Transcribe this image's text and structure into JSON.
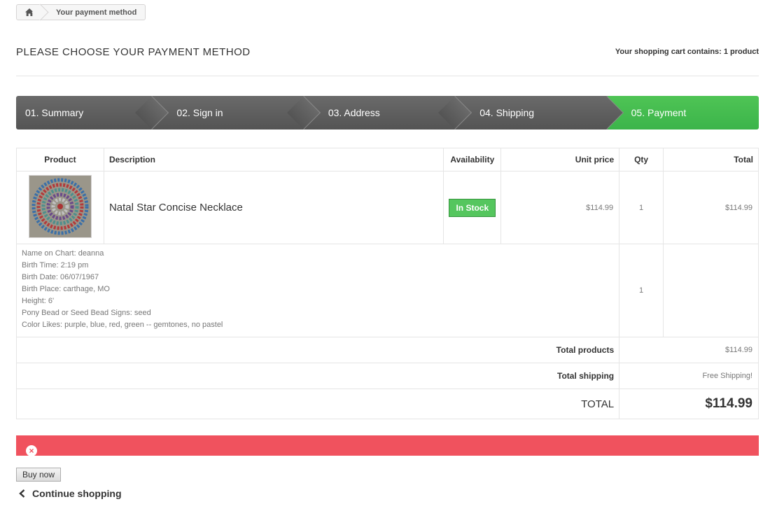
{
  "breadcrumb": {
    "home_icon": "home-icon",
    "current": "Your payment method"
  },
  "header": {
    "title": "PLEASE CHOOSE YOUR PAYMENT METHOD",
    "cart_summary": "Your shopping cart contains: 1 product"
  },
  "steps": [
    {
      "label": "01. Summary"
    },
    {
      "label": "02. Sign in"
    },
    {
      "label": "03. Address"
    },
    {
      "label": "04. Shipping"
    },
    {
      "label": "05. Payment",
      "active": true
    }
  ],
  "table": {
    "headers": {
      "product": "Product",
      "description": "Description",
      "availability": "Availability",
      "unit_price": "Unit price",
      "qty": "Qty",
      "total": "Total"
    },
    "item": {
      "name": "Natal Star Concise Necklace",
      "availability": "In Stock",
      "unit_price": "$114.99",
      "qty": "1",
      "total": "$114.99"
    },
    "customization": {
      "lines": [
        "Name on Chart: deanna",
        "Birth Time: 2:19 pm",
        "Birth Date: 06/07/1967",
        "Birth Place: carthage, MO",
        "Height: 6'",
        "Pony Bead or Seed Bead Signs: seed",
        "Color Likes: purple, blue, red, green -- gemtones, no pastel"
      ],
      "qty": "1"
    },
    "totals": {
      "products_label": "Total products",
      "products_value": "$114.99",
      "shipping_label": "Total shipping",
      "shipping_value": "Free Shipping!",
      "grand_label": "TOTAL",
      "grand_value": "$114.99"
    }
  },
  "colors": {
    "step_active": "#3bb44a",
    "step_inactive": "#5e5e5e",
    "in_stock": "#55c65e",
    "error": "#f0525e"
  },
  "error_icon": "error-circle-icon",
  "actions": {
    "buy_now": "Buy now",
    "continue_shopping": "Continue shopping"
  }
}
